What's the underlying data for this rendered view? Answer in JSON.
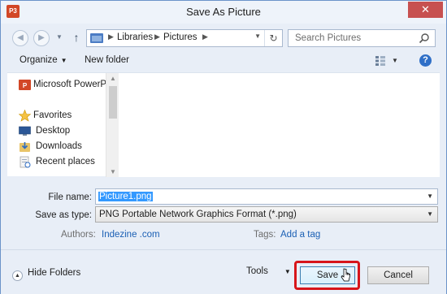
{
  "window": {
    "title": "Save As Picture",
    "app_icon_label": "P3",
    "close_label": "✕"
  },
  "nav": {
    "back_icon": "back-arrow-icon",
    "forward_icon": "forward-arrow-icon",
    "up_icon": "up-arrow-icon",
    "breadcrumbs": [
      "Libraries",
      "Pictures"
    ],
    "search_placeholder": "Search Pictures"
  },
  "toolbar": {
    "organize_label": "Organize",
    "new_folder_label": "New folder"
  },
  "sidebar": {
    "items": [
      {
        "label": "Microsoft PowerPo",
        "icon": "powerpoint-icon"
      },
      {
        "label": "Favorites",
        "icon": "star-icon"
      },
      {
        "label": "Desktop",
        "icon": "desktop-icon"
      },
      {
        "label": "Downloads",
        "icon": "downloads-icon"
      },
      {
        "label": "Recent places",
        "icon": "recent-places-icon"
      }
    ]
  },
  "form": {
    "file_name_label": "File name:",
    "file_name_value": "Picture1.png",
    "save_type_label": "Save as type:",
    "save_type_value": "PNG Portable Network Graphics Format (*.png)",
    "authors_label": "Authors:",
    "authors_value": "Indezine .com",
    "tags_label": "Tags:",
    "tags_value": "Add a tag"
  },
  "footer": {
    "hide_folders_label": "Hide Folders",
    "tools_label": "Tools",
    "save_label": "Save",
    "cancel_label": "Cancel"
  },
  "colors": {
    "window_bg": "#e8eef7",
    "close_red": "#c75050",
    "highlight_red": "#d7151a",
    "link_blue": "#1a5fb4",
    "selection_blue": "#3399ff"
  }
}
